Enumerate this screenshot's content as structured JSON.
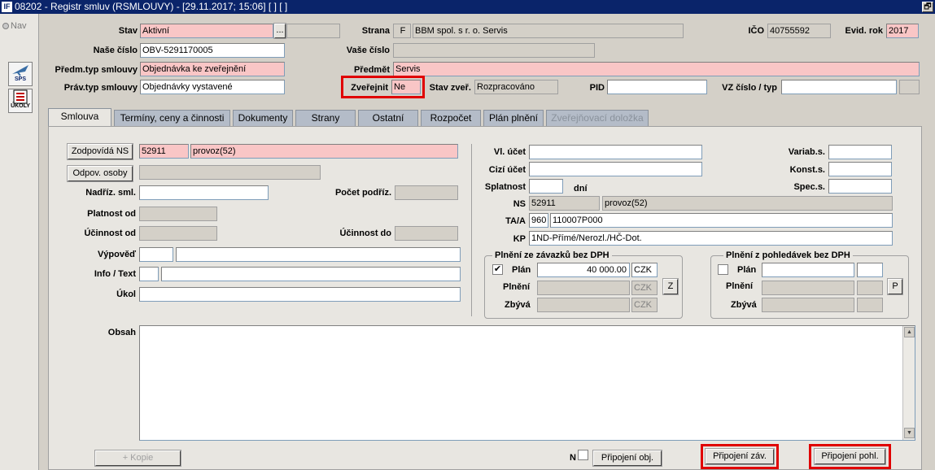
{
  "window": {
    "title": "08202 - Registr smluv (RSMLOUVY) - [29.11.2017; 15:06] [ ] [ ]",
    "logo": "IF",
    "restore_glyph": "🗗"
  },
  "left_panel": {
    "nav_label": "Nav",
    "sps_label": "SPS",
    "ukoly_label": "ÚKOLY"
  },
  "header": {
    "stav_label": "Stav",
    "stav_value": "Aktivní",
    "stav_btn": "...",
    "stav_extra": "",
    "strana_label": "Strana",
    "strana_code": "F",
    "strana_name": "BBM spol. s r. o. Servis",
    "ico_label": "IČO",
    "ico_value": "40755592",
    "evid_rok_label": "Evid. rok",
    "evid_rok_value": "2017",
    "nase_cislo_label": "Naše číslo",
    "nase_cislo_value": "OBV-5291170005",
    "vase_cislo_label": "Vaše číslo",
    "vase_cislo_value": "",
    "predm_typ_label": "Předm.typ smlouvy",
    "predm_typ_value": "Objednávka ke zveřejnění",
    "predmet_label": "Předmět",
    "predmet_value": "Servis",
    "prav_typ_label": "Práv.typ smlouvy",
    "prav_typ_value": "Objednávky vystavené",
    "zverejnit_label": "Zveřejnit",
    "zverejnit_value": "Ne",
    "stav_zver_label": "Stav zveř.",
    "stav_zver_value": "Rozpracováno",
    "pid_label": "PID",
    "pid_value": "",
    "vz_label": "VZ číslo / typ",
    "vz_value": "",
    "vz_typ": ""
  },
  "tabs": [
    "Smlouva",
    "Termíny, ceny a činnosti",
    "Dokumenty",
    "Strany",
    "Ostatní",
    "Rozpočet",
    "Plán plnění",
    "Zveřejňovací doložka"
  ],
  "form": {
    "zodpovida_btn": "Zodpovídá NS",
    "zodpovida_code": "52911",
    "zodpovida_name": "provoz(52)",
    "odpov_btn": "Odpov. osoby",
    "odpov_value": "",
    "nadriz_label": "Nadříz. sml.",
    "nadriz_value": "",
    "pocet_label": "Počet podříz.",
    "pocet_value": "",
    "platnost_label": "Platnost od",
    "platnost_value": "",
    "ucinnost_od_label": "Účinnost od",
    "ucinnost_od_value": "",
    "ucinnost_do_label": "Účinnost do",
    "ucinnost_do_value": "",
    "vypoved_label": "Výpověď",
    "vypoved_a": "",
    "vypoved_b": "",
    "info_label": "Info / Text",
    "info_a": "",
    "info_b": "",
    "ukol_label": "Úkol",
    "ukol_value": "",
    "vl_ucet_label": "Vl. účet",
    "vl_ucet_value": "",
    "cizi_ucet_label": "Cizí účet",
    "cizi_ucet_value": "",
    "splatnost_label": "Splatnost",
    "splatnost_value": "",
    "splatnost_unit": "dní",
    "variab_label": "Variab.s.",
    "variab_value": "",
    "konst_label": "Konst.s.",
    "konst_value": "",
    "spec_label": "Spec.s.",
    "spec_value": "",
    "ns_label": "NS",
    "ns_code": "52911",
    "ns_name": "provoz(52)",
    "taa_label": "TA/A",
    "taa_code": "960",
    "taa_value": "110007P000",
    "kp_label": "KP",
    "kp_value": "1ND-Přímé/Nerozl./HČ-Dot."
  },
  "plneni_zav": {
    "title": "Plnění ze závazků bez DPH",
    "plan_label": "Plán",
    "plan_checked": true,
    "plan_value": "40 000.00",
    "plan_cur": "CZK",
    "plneni_label": "Plnění",
    "plneni_value": "",
    "plneni_cur": "CZK",
    "z_btn": "Z",
    "zbyva_label": "Zbývá",
    "zbyva_value": "",
    "zbyva_cur": "CZK"
  },
  "plneni_pohl": {
    "title": "Plnění z pohledávek bez DPH",
    "plan_label": "Plán",
    "plan_checked": false,
    "plan_value": "",
    "plan_cur": "",
    "plneni_label": "Plnění",
    "plneni_value": "",
    "plneni_cur": "",
    "p_btn": "P",
    "zbyva_label": "Zbývá",
    "zbyva_value": "",
    "zbyva_cur": ""
  },
  "obsah": {
    "label": "Obsah",
    "value": ""
  },
  "footer": {
    "kopie_btn": "+ Kopie",
    "n_label": "N",
    "pripojeni_obj": "Připojení obj.",
    "pripojeni_zav": "Připojení záv.",
    "pripojeni_pohl": "Připojení pohl."
  },
  "colors": {
    "titlebar": "#0a246a",
    "highlight_red": "#e00000",
    "pink_field": "#f9c6c6",
    "tab_bg": "#b4bcc8"
  }
}
